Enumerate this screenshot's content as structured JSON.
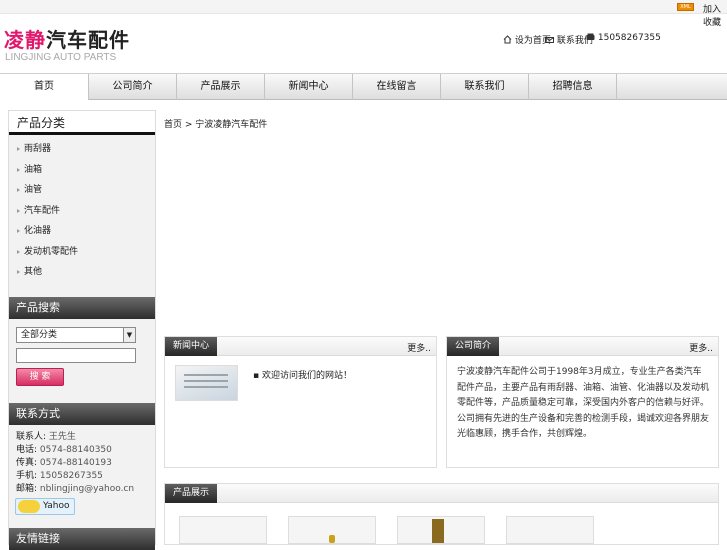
{
  "topbar": {
    "xml_badge": "XML",
    "link": "加入收藏"
  },
  "logo": {
    "cn_red": "凌静",
    "cn_rest": "汽车配件",
    "en": "LINGJING AUTO PARTS"
  },
  "toplinks": {
    "home": "设为首页",
    "mail": "联系我们",
    "phone": "15058267355"
  },
  "nav": [
    "首页",
    "公司简介",
    "产品展示",
    "新闻中心",
    "在线留言",
    "联系我们",
    "招聘信息"
  ],
  "sidebar": {
    "cat_title": "产品分类",
    "categories": [
      "雨刮器",
      "油箱",
      "油管",
      "汽车配件",
      "化油器",
      "发动机零配件",
      "其他"
    ],
    "search_title": "产品搜索",
    "select_value": "全部分类",
    "search_button": "搜 索",
    "contact_title": "联系方式",
    "contact": [
      {
        "k": "联系人:",
        "v": "王先生"
      },
      {
        "k": "电话:",
        "v": "0574-88140350"
      },
      {
        "k": "传真:",
        "v": "0574-88140193"
      },
      {
        "k": "手机:",
        "v": "15058267355"
      },
      {
        "k": "邮箱:",
        "v": "nblingjing@yahoo.cn"
      }
    ],
    "yahoo": "Yahoo",
    "last_title": "友情链接"
  },
  "breadcrumb": "首页 > 宁波凌静汽车配件",
  "news": {
    "title": "新闻中心",
    "more": "更多..",
    "item": "欢迎访问我们的网站！"
  },
  "about": {
    "title": "公司简介",
    "more": "更多..",
    "text": "宁波凌静汽车配件公司于1998年3月成立，专业生产各类汽车配件产品，主要产品有雨刮器、油箱、油管、化油器以及发动机零配件等，产品质量稳定可靠，深受国内外客户的信赖与好评。公司拥有先进的生产设备和完善的检测手段，竭诚欢迎各界朋友光临惠顾，携手合作，共创辉煌。"
  },
  "products": {
    "title": "产品展示"
  }
}
